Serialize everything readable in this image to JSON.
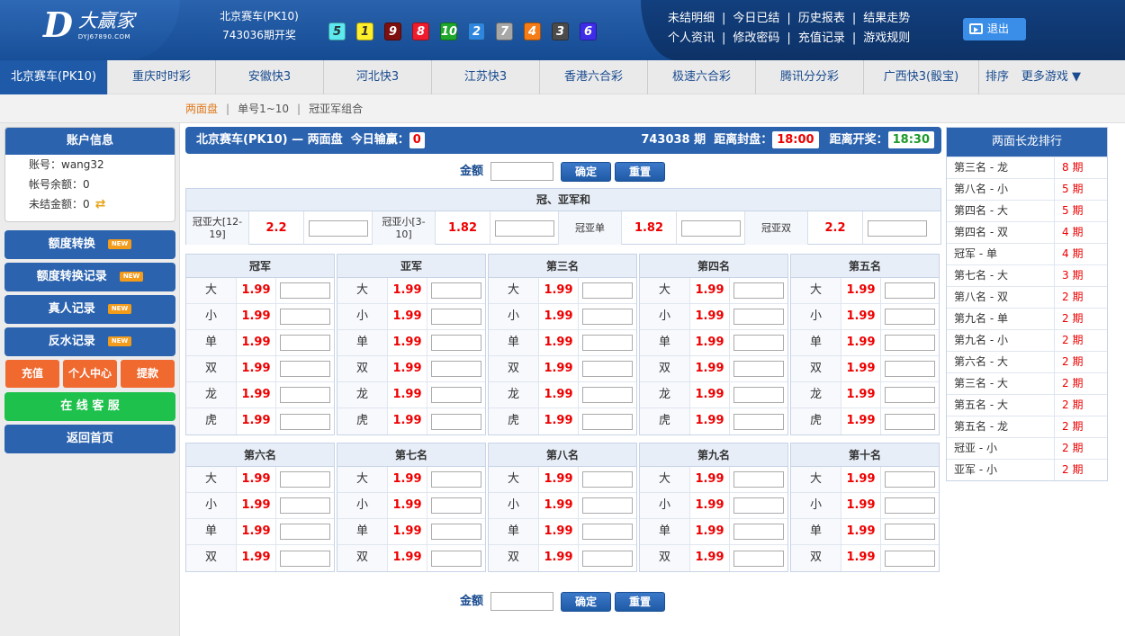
{
  "header": {
    "logo_mark": "D",
    "logo_text": "大赢家",
    "logo_url": "DYJ67890.COM",
    "lottery_name": "北京赛车(PK10)",
    "draw_info": "743036期开奖",
    "balls": [
      {
        "num": "5",
        "color": "#5ee8f0",
        "fg": "#233"
      },
      {
        "num": "1",
        "color": "#ffef2a",
        "fg": "#333"
      },
      {
        "num": "9",
        "color": "#7d0f0f",
        "fg": "#fff"
      },
      {
        "num": "8",
        "color": "#ee1c2c",
        "fg": "#fff"
      },
      {
        "num": "10",
        "color": "#1fa62c",
        "fg": "#fff"
      },
      {
        "num": "2",
        "color": "#2e86de",
        "fg": "#fff"
      },
      {
        "num": "7",
        "color": "#a7a7a7",
        "fg": "#fff"
      },
      {
        "num": "4",
        "color": "#f57c16",
        "fg": "#fff"
      },
      {
        "num": "3",
        "color": "#4b4b4b",
        "fg": "#fff"
      },
      {
        "num": "6",
        "color": "#3d2de8",
        "fg": "#fff"
      }
    ],
    "links_row1": [
      "未结明细",
      "今日已结",
      "历史报表",
      "结果走势"
    ],
    "links_row2": [
      "个人资讯",
      "修改密码",
      "充值记录",
      "游戏规则"
    ],
    "logout": "退出"
  },
  "nav": {
    "tabs": [
      "北京赛车(PK10)",
      "重庆时时彩",
      "安徽快3",
      "河北快3",
      "江苏快3",
      "香港六合彩",
      "极速六合彩",
      "腾讯分分彩",
      "广西快3(骰宝)"
    ],
    "sort": "排序",
    "more": "更多游戏 ▼"
  },
  "subnav": [
    "两面盘",
    "单号1~10",
    "冠亚军组合"
  ],
  "sidebar": {
    "account_title": "账户信息",
    "account_label": "账号：",
    "account_value": "wang32",
    "balance_label": "帐号余额：",
    "balance_value": "0",
    "unsettled_label": "未结金额：",
    "unsettled_value": "0",
    "buttons": [
      "额度转换",
      "额度转换记录",
      "真人记录",
      "反水记录"
    ],
    "new_tag": "NEW",
    "orange_buttons": [
      "充值",
      "个人中心",
      "提款"
    ],
    "service": "在 线 客 服",
    "home": "返回首页"
  },
  "main": {
    "bar_title": "北京赛车(PK10) — 两面盘",
    "today_label": "今日输赢：",
    "today_value": "0",
    "period": "743038 期",
    "close_label": "距离封盘：",
    "close_time": "18:00",
    "open_label": "距离开奖：",
    "open_time": "18:30",
    "amount_label": "金额",
    "confirm": "确定",
    "reset": "重置",
    "gyh_title": "冠、亚军和",
    "gyh_cells": [
      {
        "label": "冠亚大[12-19]",
        "odds": "2.2"
      },
      {
        "label": "冠亚小[3-10]",
        "odds": "1.82"
      },
      {
        "label": "冠亚单",
        "odds": "1.82"
      },
      {
        "label": "冠亚双",
        "odds": "2.2"
      }
    ],
    "tables_top": [
      {
        "title": "冠军",
        "rows": [
          [
            "大",
            "1.99"
          ],
          [
            "小",
            "1.99"
          ],
          [
            "单",
            "1.99"
          ],
          [
            "双",
            "1.99"
          ],
          [
            "龙",
            "1.99"
          ],
          [
            "虎",
            "1.99"
          ]
        ]
      },
      {
        "title": "亚军",
        "rows": [
          [
            "大",
            "1.99"
          ],
          [
            "小",
            "1.99"
          ],
          [
            "单",
            "1.99"
          ],
          [
            "双",
            "1.99"
          ],
          [
            "龙",
            "1.99"
          ],
          [
            "虎",
            "1.99"
          ]
        ]
      },
      {
        "title": "第三名",
        "rows": [
          [
            "大",
            "1.99"
          ],
          [
            "小",
            "1.99"
          ],
          [
            "单",
            "1.99"
          ],
          [
            "双",
            "1.99"
          ],
          [
            "龙",
            "1.99"
          ],
          [
            "虎",
            "1.99"
          ]
        ]
      },
      {
        "title": "第四名",
        "rows": [
          [
            "大",
            "1.99"
          ],
          [
            "小",
            "1.99"
          ],
          [
            "单",
            "1.99"
          ],
          [
            "双",
            "1.99"
          ],
          [
            "龙",
            "1.99"
          ],
          [
            "虎",
            "1.99"
          ]
        ]
      },
      {
        "title": "第五名",
        "rows": [
          [
            "大",
            "1.99"
          ],
          [
            "小",
            "1.99"
          ],
          [
            "单",
            "1.99"
          ],
          [
            "双",
            "1.99"
          ],
          [
            "龙",
            "1.99"
          ],
          [
            "虎",
            "1.99"
          ]
        ]
      }
    ],
    "tables_bottom": [
      {
        "title": "第六名",
        "rows": [
          [
            "大",
            "1.99"
          ],
          [
            "小",
            "1.99"
          ],
          [
            "单",
            "1.99"
          ],
          [
            "双",
            "1.99"
          ]
        ]
      },
      {
        "title": "第七名",
        "rows": [
          [
            "大",
            "1.99"
          ],
          [
            "小",
            "1.99"
          ],
          [
            "单",
            "1.99"
          ],
          [
            "双",
            "1.99"
          ]
        ]
      },
      {
        "title": "第八名",
        "rows": [
          [
            "大",
            "1.99"
          ],
          [
            "小",
            "1.99"
          ],
          [
            "单",
            "1.99"
          ],
          [
            "双",
            "1.99"
          ]
        ]
      },
      {
        "title": "第九名",
        "rows": [
          [
            "大",
            "1.99"
          ],
          [
            "小",
            "1.99"
          ],
          [
            "单",
            "1.99"
          ],
          [
            "双",
            "1.99"
          ]
        ]
      },
      {
        "title": "第十名",
        "rows": [
          [
            "大",
            "1.99"
          ],
          [
            "小",
            "1.99"
          ],
          [
            "单",
            "1.99"
          ],
          [
            "双",
            "1.99"
          ]
        ]
      }
    ]
  },
  "dragon": {
    "title": "两面长龙排行",
    "rows": [
      [
        "第三名 - 龙",
        "8 期"
      ],
      [
        "第八名 - 小",
        "5 期"
      ],
      [
        "第四名 - 大",
        "5 期"
      ],
      [
        "第四名 - 双",
        "4 期"
      ],
      [
        "冠军 - 单",
        "4 期"
      ],
      [
        "第七名 - 大",
        "3 期"
      ],
      [
        "第八名 - 双",
        "2 期"
      ],
      [
        "第九名 - 单",
        "2 期"
      ],
      [
        "第九名 - 小",
        "2 期"
      ],
      [
        "第六名 - 大",
        "2 期"
      ],
      [
        "第三名 - 大",
        "2 期"
      ],
      [
        "第五名 - 大",
        "2 期"
      ],
      [
        "第五名 - 龙",
        "2 期"
      ],
      [
        "冠亚 - 小",
        "2 期"
      ],
      [
        "亚军 - 小",
        "2 期"
      ]
    ]
  }
}
